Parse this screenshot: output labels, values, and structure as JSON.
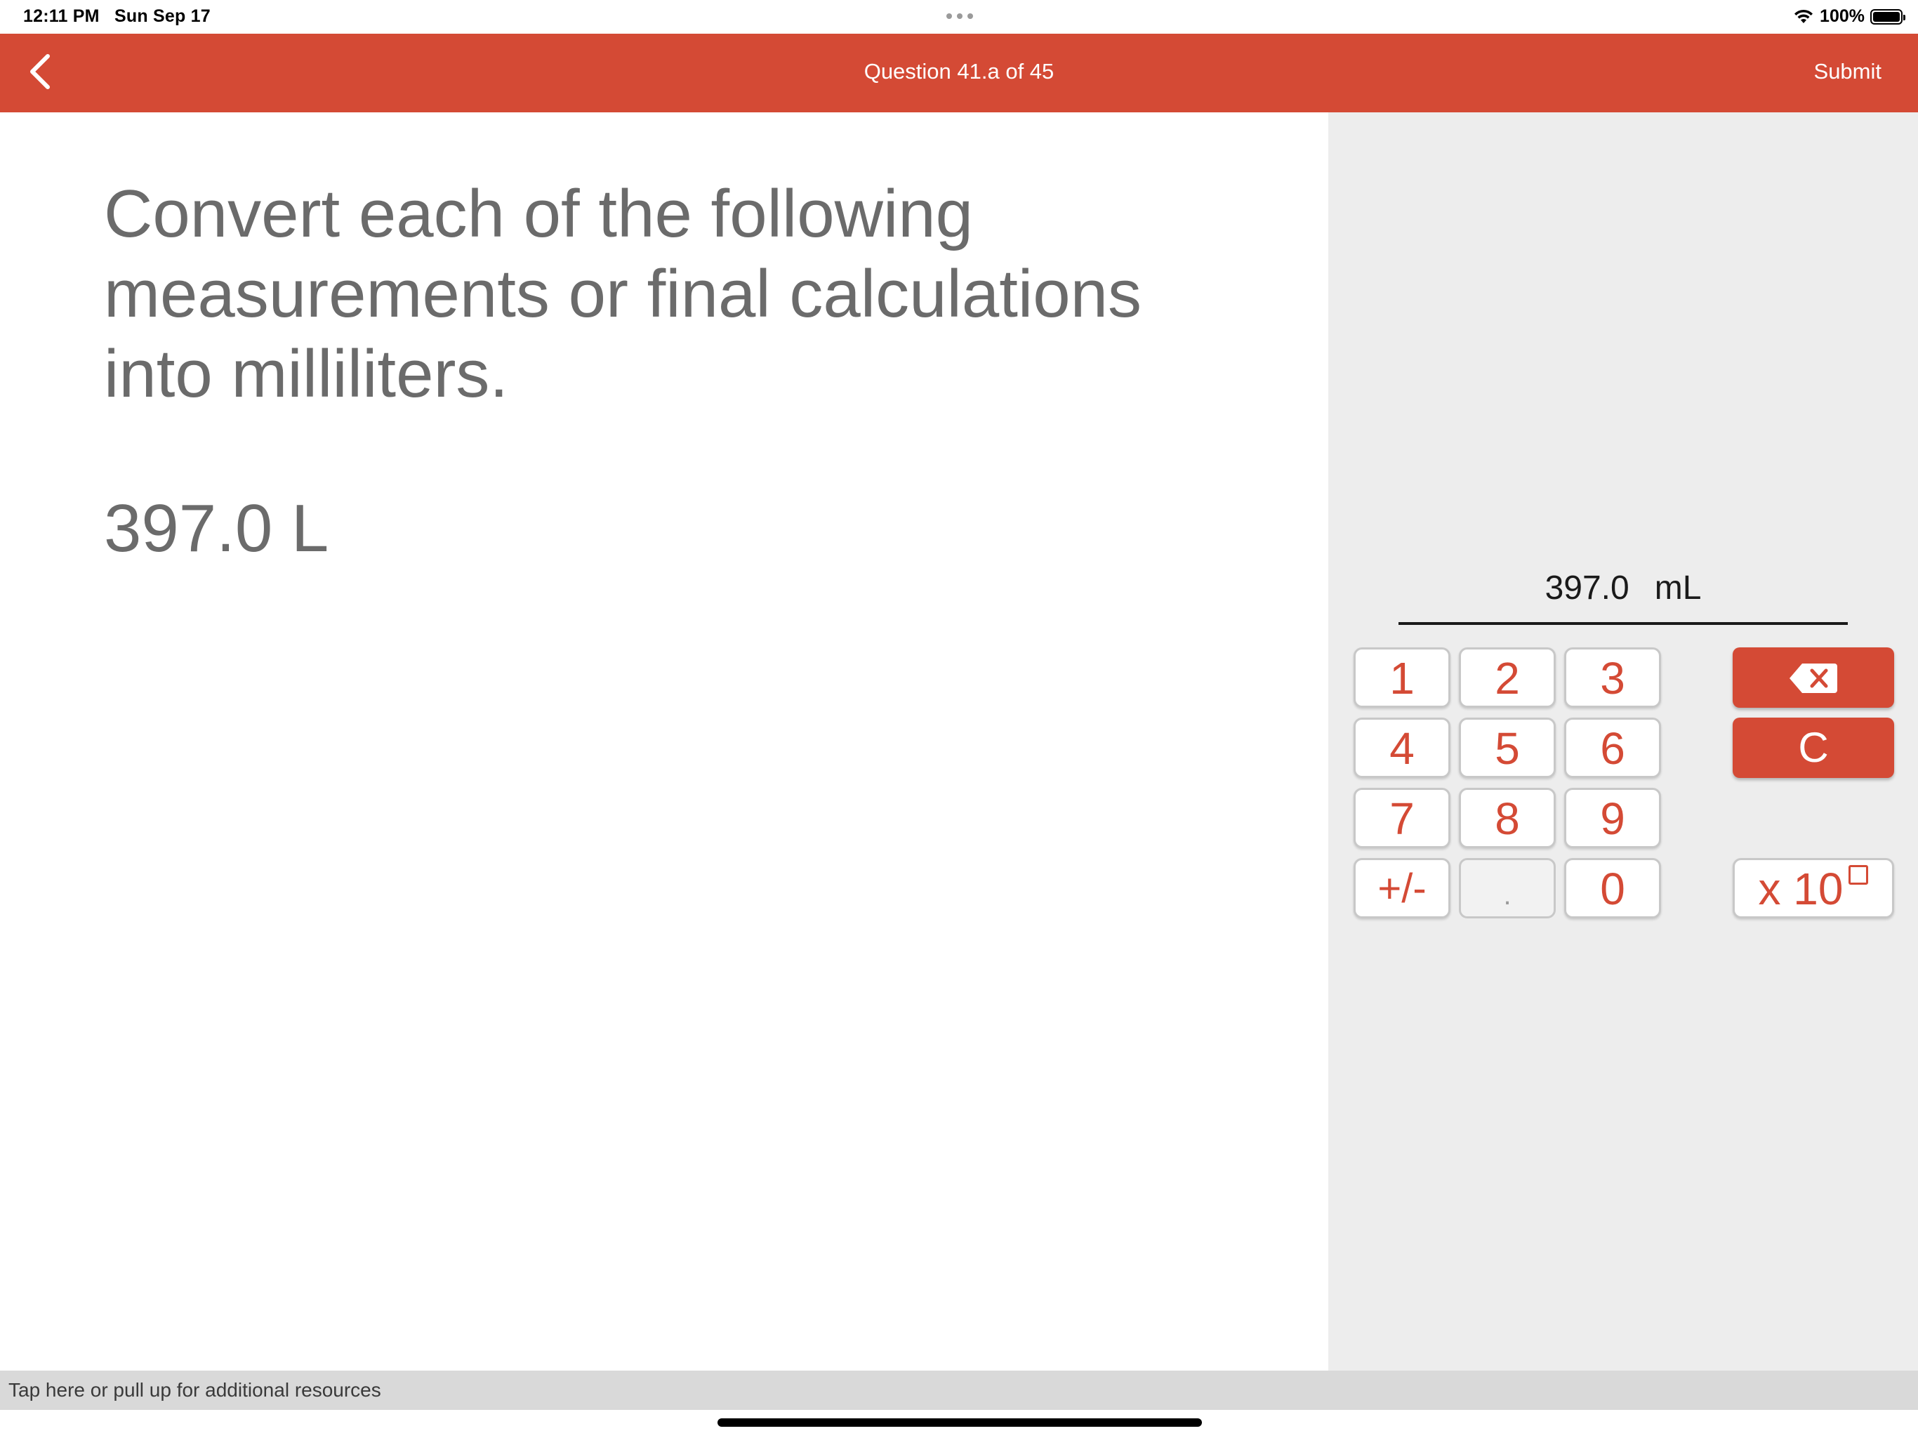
{
  "status_bar": {
    "time": "12:11 PM",
    "date": "Sun Sep 17",
    "battery": "100%",
    "wifi_icon": "wifi-icon",
    "battery_icon": "battery-icon"
  },
  "nav": {
    "back_icon": "chevron-left-icon",
    "title": "Question 41.a of 45",
    "submit_label": "Submit"
  },
  "question": {
    "text": "Convert each of the following measurements or final calculations into milliliters.",
    "given": "397.0 L"
  },
  "answer": {
    "value": "397.0",
    "unit": "mL"
  },
  "keypad": {
    "keys": [
      "1",
      "2",
      "3",
      "4",
      "5",
      "6",
      "7",
      "8",
      "9",
      "+/-",
      ".",
      "0"
    ],
    "decimal_disabled": true,
    "backspace_icon": "backspace-icon",
    "clear_label": "C",
    "sci_label": "x 10"
  },
  "colors": {
    "accent": "#d44a35",
    "pane_gray": "#ededed",
    "text_gray": "#6b6b6b"
  },
  "resources": {
    "label": "Tap here or pull up for additional resources"
  }
}
